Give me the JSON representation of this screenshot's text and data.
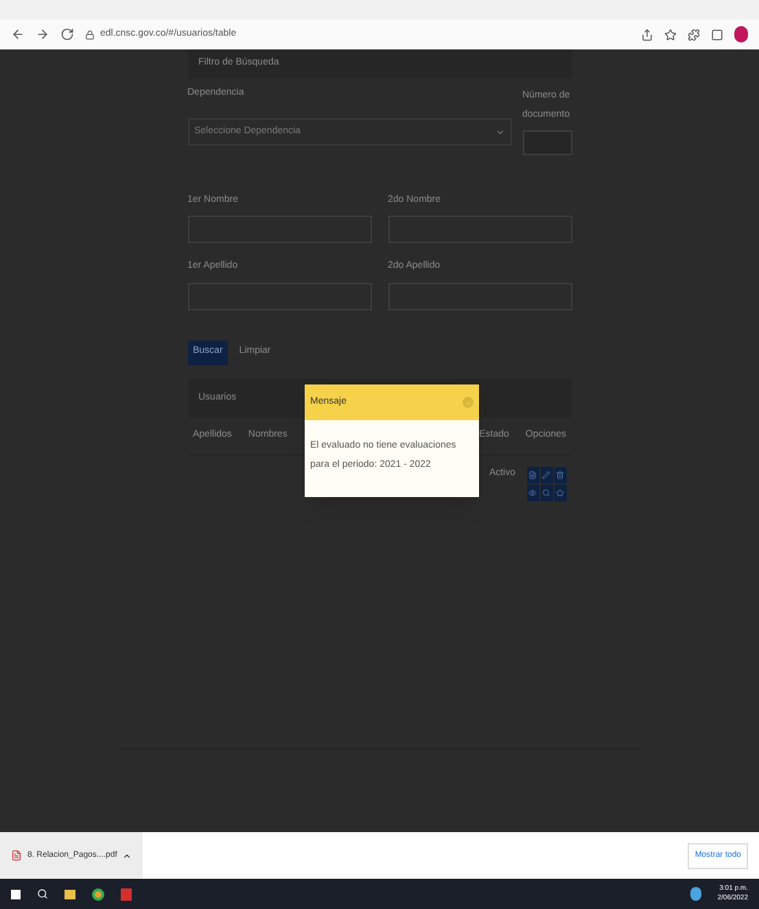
{
  "browser": {
    "url": "edl.cnsc.gov.co/#/usuarios/table"
  },
  "filter": {
    "title": "Filtro de Búsqueda",
    "dependency_label": "Dependencia",
    "dependency_placeholder": "Seleccione Dependencia",
    "document_label": "Número de documento",
    "fields": [
      {
        "label": "1er Nombre"
      },
      {
        "label": "2do Nombre"
      },
      {
        "label": "1er Apellido"
      },
      {
        "label": "2do Apellido"
      }
    ]
  },
  "buttons": [
    {
      "label": "Buscar",
      "kind": "primary"
    },
    {
      "label": "Limpiar",
      "kind": "link"
    }
  ],
  "table": {
    "title": "Usuarios",
    "columns": [
      "Apellidos",
      "Nombres",
      "Estado",
      "Opciones"
    ],
    "rows": [
      {
        "estado": "Activo"
      }
    ]
  },
  "modal": {
    "title": "Mensaje",
    "message": "El evaluado no tiene evaluaciones para el periodo: 2021 - 2022"
  },
  "downloads": {
    "file": "8. Relacion_Pagos....pdf",
    "show_all": "Mostrar todo"
  },
  "taskbar": {
    "time": "3:01 p.m.",
    "date": "2/06/2022"
  }
}
